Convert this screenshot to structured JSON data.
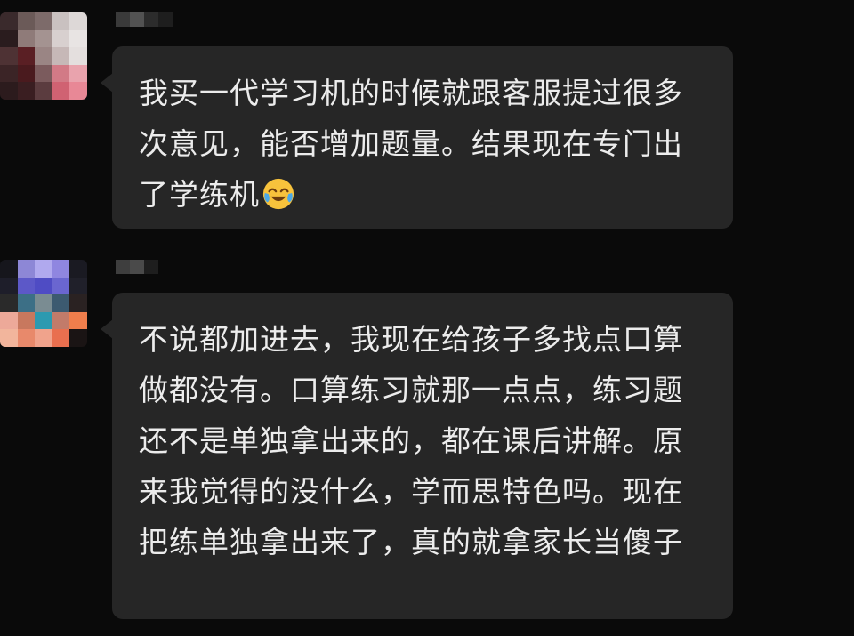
{
  "messages": [
    {
      "text": "我买一代学习机的时候就跟客服提过很多次意见，能否增加题量。结果现在专门出了学练机",
      "emoji": "face-with-tears-of-joy-icon"
    },
    {
      "text": "不说都加进去，我现在给孩子多找点口算做都没有。口算练习就那一点点，练习题还不是单独拿出来的，都在课后讲解。原来我觉得的没什么，学而思特色吗。现在把练单独拿出来了，真的就拿家长当傻子"
    }
  ],
  "colors": {
    "background": "#0a0a0a",
    "bubble": "#262626",
    "text": "#ececec"
  }
}
